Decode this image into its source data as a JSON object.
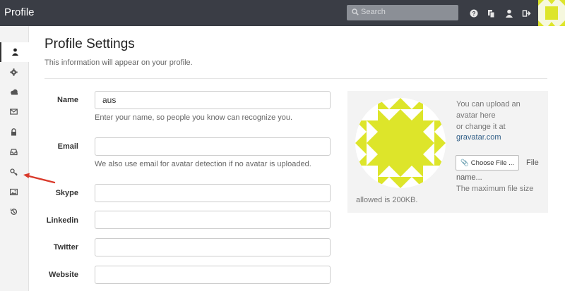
{
  "app": {
    "title": "Profile"
  },
  "search": {
    "placeholder": "Search"
  },
  "topbar_icons": [
    "help-icon",
    "files-icon",
    "user-icon",
    "logout-icon"
  ],
  "sidebar": {
    "items": [
      {
        "name": "sidebar-item-profile",
        "icon": "user-icon",
        "active": true
      },
      {
        "name": "sidebar-item-settings",
        "icon": "gear-icon"
      },
      {
        "name": "sidebar-item-cloud",
        "icon": "cloud-icon"
      },
      {
        "name": "sidebar-item-mail",
        "icon": "envelope-icon"
      },
      {
        "name": "sidebar-item-security",
        "icon": "lock-icon"
      },
      {
        "name": "sidebar-item-inbox",
        "icon": "inbox-icon"
      },
      {
        "name": "sidebar-item-keys",
        "icon": "key-icon"
      },
      {
        "name": "sidebar-item-images",
        "icon": "image-icon"
      },
      {
        "name": "sidebar-item-history",
        "icon": "history-icon"
      }
    ]
  },
  "header": {
    "title": "Profile Settings",
    "subtitle": "This information will appear on your profile."
  },
  "form": {
    "name": {
      "label": "Name",
      "value": "aus",
      "help": "Enter your name, so people you know can recognize you."
    },
    "email": {
      "label": "Email",
      "value": "",
      "help": "We also use email for avatar detection if no avatar is uploaded."
    },
    "skype": {
      "label": "Skype",
      "value": ""
    },
    "linkedin": {
      "label": "Linkedin",
      "value": ""
    },
    "twitter": {
      "label": "Twitter",
      "value": ""
    },
    "website": {
      "label": "Website",
      "value": ""
    }
  },
  "avatar": {
    "line1": "You can upload an",
    "line2": "avatar here",
    "line3": "or change it at",
    "link": "gravatar.com",
    "choose_label": "Choose File ...",
    "file_word": "File",
    "file_name": "name...",
    "max_line": "The maximum file size",
    "allowed_line": "allowed is 200KB.",
    "colors": {
      "fg": "#dde52a",
      "bg": "#ffffff"
    }
  }
}
